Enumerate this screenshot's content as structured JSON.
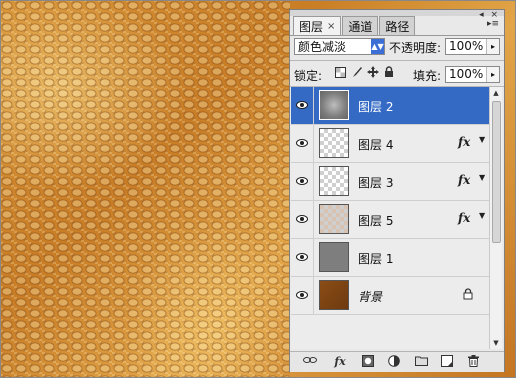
{
  "tabs": [
    {
      "label": "图层",
      "active": true,
      "close": "×"
    },
    {
      "label": "通道",
      "active": false
    },
    {
      "label": "路径",
      "active": false
    }
  ],
  "window_controls": "◂ ×",
  "menu_icon": "▸≡",
  "blend_mode": {
    "value": "颜色减淡"
  },
  "opacity": {
    "label": "不透明度:",
    "value": "100%"
  },
  "lock": {
    "label": "锁定:",
    "icons": [
      "lock-transparent-icon",
      "lock-brush-icon",
      "lock-move-icon",
      "lock-all-icon"
    ]
  },
  "fill": {
    "label": "填充:",
    "value": "100%"
  },
  "layers": [
    {
      "name": "图层 2",
      "selected": true,
      "thumb": "gray-blur",
      "fx": false
    },
    {
      "name": "图层 4",
      "selected": false,
      "thumb": "checker",
      "fx": true
    },
    {
      "name": "图层 3",
      "selected": false,
      "thumb": "checker",
      "fx": true
    },
    {
      "name": "图层 5",
      "selected": false,
      "thumb": "checker-brown",
      "fx": true
    },
    {
      "name": "图层 1",
      "selected": false,
      "thumb": "gray",
      "fx": false
    },
    {
      "name": "背景",
      "selected": false,
      "thumb": "brown",
      "fx": false,
      "locked": true
    }
  ],
  "fx_label": "fx",
  "bottom_icons": [
    "link-icon",
    "fx-icon",
    "mask-icon",
    "adjustment-icon",
    "folder-icon",
    "new-layer-icon",
    "trash-icon"
  ],
  "colors": {
    "selected": "#3469c4",
    "canvas": "#d99436"
  }
}
